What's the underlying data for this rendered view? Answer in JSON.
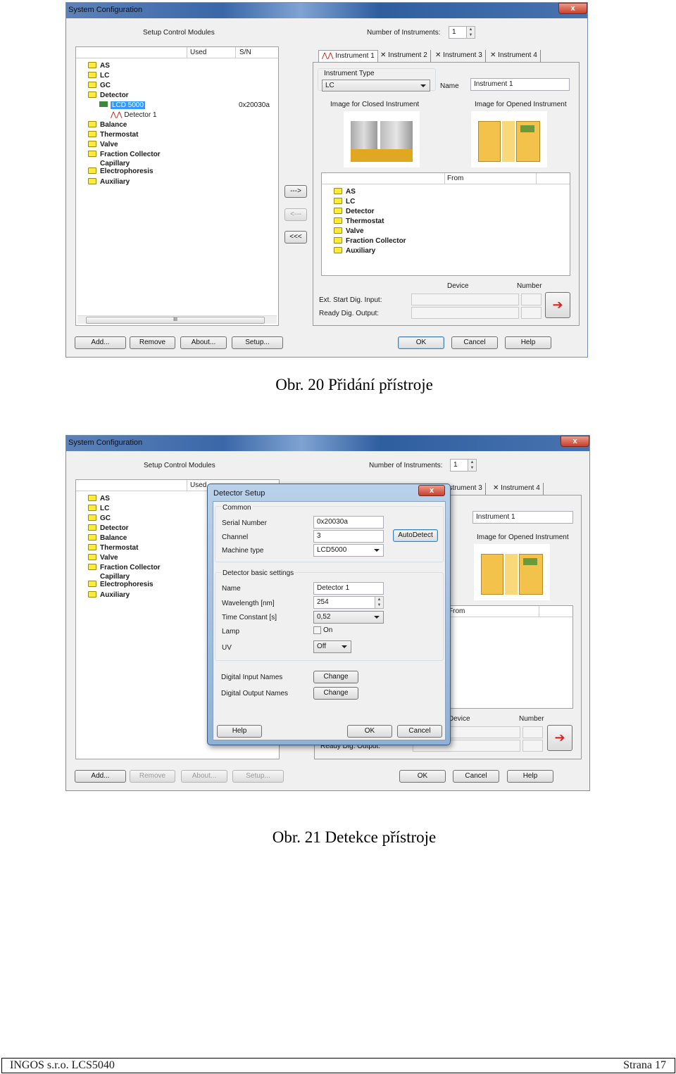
{
  "figure1": {
    "window_title": "System Configuration",
    "close_label": "x",
    "setup_modules_label": "Setup Control Modules",
    "num_instruments_label": "Number of Instruments:",
    "num_instruments_value": "1",
    "tree_columns": [
      "Used",
      "S/N"
    ],
    "tree": [
      {
        "label": "AS",
        "level": 0
      },
      {
        "label": "LC",
        "level": 0
      },
      {
        "label": "GC",
        "level": 0
      },
      {
        "label": "Detector",
        "level": 0,
        "expanded": true
      },
      {
        "label": "LCD 5000",
        "level": 1,
        "selected": true,
        "sn": "0x20030a"
      },
      {
        "label": "Detector 1",
        "level": 2
      },
      {
        "label": "Balance",
        "level": 0
      },
      {
        "label": "Thermostat",
        "level": 0
      },
      {
        "label": "Valve",
        "level": 0
      },
      {
        "label": "Fraction Collector",
        "level": 0
      },
      {
        "label": "Capillary Electrophoresis",
        "level": 0
      },
      {
        "label": "Auxiliary",
        "level": 0
      }
    ],
    "scroll_grip": "III",
    "move_buttons": [
      "--->",
      "<---",
      "<<<"
    ],
    "tabs": [
      "Instrument 1",
      "Instrument 2",
      "Instrument 3",
      "Instrument 4"
    ],
    "instrument_type_label": "Instrument Type",
    "instrument_type_value": "LC",
    "name_label": "Name",
    "name_value": "Instrument 1",
    "image_closed_label": "Image for Closed Instrument",
    "image_opened_label": "Image for Opened Instrument",
    "list_columns": [
      "From"
    ],
    "list_items": [
      "AS",
      "LC",
      "Detector",
      "Thermostat",
      "Valve",
      "Fraction Collector",
      "Auxiliary"
    ],
    "device_label": "Device",
    "number_label": "Number",
    "ext_start_label": "Ext. Start Dig. Input:",
    "ready_output_label": "Ready Dig. Output:",
    "buttons": {
      "add": "Add...",
      "remove": "Remove",
      "about": "About...",
      "setup": "Setup...",
      "ok": "OK",
      "cancel": "Cancel",
      "help": "Help"
    },
    "caption": "Obr. 20 Přidání přístroje"
  },
  "figure2": {
    "window_title": "System Configuration",
    "close_label": "x",
    "setup_modules_label": "Setup Control Modules",
    "num_instruments_label": "Number of Instruments:",
    "num_instruments_value": "1",
    "tree_columns": [
      "Used"
    ],
    "tree": [
      "AS",
      "LC",
      "GC",
      "Detector",
      "Balance",
      "Thermostat",
      "Valve",
      "Fraction Collector",
      "Capillary Electrophoresis",
      "Auxiliary"
    ],
    "tabs": [
      "Instrument 3",
      "Instrument 4"
    ],
    "name_value": "Instrument 1",
    "image_opened_label": "Image for Opened Instrument",
    "list_columns": [
      "From"
    ],
    "device_label": "Device",
    "number_label": "Number",
    "ready_output_label": "Ready Dig. Output:",
    "buttons": {
      "add": "Add...",
      "remove": "Remove",
      "about": "About...",
      "setup": "Setup...",
      "ok": "OK",
      "cancel": "Cancel",
      "help": "Help"
    },
    "dialog": {
      "title": "Detector Setup",
      "close_label": "x",
      "common_group": "Common",
      "serial_label": "Serial Number",
      "serial_value": "0x20030a",
      "channel_label": "Channel",
      "channel_value": "3",
      "machine_label": "Machine type",
      "machine_value": "LCD5000",
      "autodetect": "AutoDetect",
      "basic_group": "Detector basic settings",
      "name_label": "Name",
      "name_value": "Detector 1",
      "wavelength_label": "Wavelength [nm]",
      "wavelength_value": "254",
      "time_constant_label": "Time Constant [s]",
      "time_constant_value": "0,52",
      "lamp_label": "Lamp",
      "lamp_checkbox_label": "On",
      "lamp_on": false,
      "uv_label": "UV",
      "uv_value": "Off",
      "digital_input_label": "Digital Input Names",
      "digital_output_label": "Digital Output Names",
      "change": "Change",
      "help": "Help",
      "ok": "OK",
      "cancel": "Cancel"
    },
    "caption": "Obr. 21 Detekce přístroje"
  },
  "footer": {
    "left": "INGOS s.r.o. LCS5040",
    "right": "Strana 17"
  }
}
